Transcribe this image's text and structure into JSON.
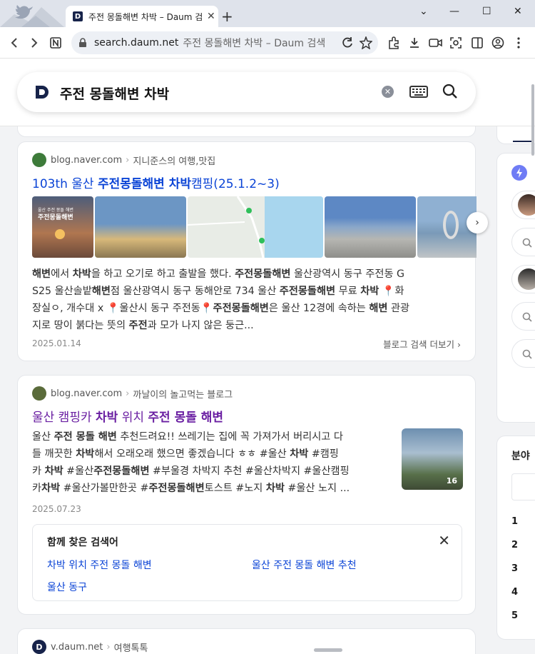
{
  "browser": {
    "tab_title": "주전 몽돌해변 차박 – Daum 검색",
    "tab_favicon": "D",
    "close_glyph": "✕",
    "new_tab_glyph": "+",
    "url": "search.daum.net",
    "url_title": "주전 몽돌해변 차박 – Daum 검색",
    "win_down": "⌄",
    "win_min": "—",
    "win_max": "☐",
    "win_close": "✕"
  },
  "search": {
    "query": "주전 몽돌해변 차박"
  },
  "results": [
    {
      "domain": "blog.naver.com",
      "blog_name": "지니준스의 여행,맛집",
      "title_pre": "103th 울산 ",
      "title_bold": "주전몽돌해변 차박",
      "title_post": "캠핑(25.1.2~3)",
      "desc_lines": [
        "<b>해변</b>에서 <b>차박</b>을 하고 오기로 하고 출발을 했다. <b>주전몽돌해변</b> 울산광역시 동구 주전동 G",
        "S25 울산솔밭<b>해변</b>점 울산광역시 동구 동해안로 734  울산 <b>주전몽돌해변</b> 무료 <b>차박</b> 📍화",
        "장실ㅇ, 개수대 x 📍울산시 동구 주전동📍<b>주전몽돌해변</b>은 울산 12경에 속하는 <b>해변</b> 관광",
        "지로 땅이 붉다는 뜻의 <b>주전</b>과 모가 나지 않은 둥근..."
      ],
      "date": "2025.01.14",
      "more_label": "블로그 검색 더보기 ›",
      "thumb_next": "›"
    },
    {
      "domain": "blog.naver.com",
      "blog_name": "까날이의 놀고먹는 블로그",
      "title_html": "울산 캠핑카 <b>차박</b> 위치 <b>주전 몽돌 해변</b>",
      "desc_lines": [
        "울산 <b>주전 몽돌 해변</b> 추천드려요!! 쓰레기는 집에 꼭 가져가서 버리시고 다",
        "들 깨끗한 <b>차박</b>해서 오래오래 했으면 좋겠습니다 ㅎㅎ  #울산 <b>차박</b> #캠핑",
        "카 <b>차박</b> #울산<b>주전몽돌해변</b> #부울경 차박지 추천 #울산차박지 #울산캠핑",
        "카<b>차박</b> #울산가볼만한곳 #<b>주전몽돌해변</b>토스트 #노지 <b>차박</b> #울산 노지 ..."
      ],
      "thumb_count": "16",
      "date": "2025.07.23"
    }
  ],
  "related": {
    "title": "함께 찾은 검색어",
    "close": "✕",
    "items": [
      "차박 위치 주전 몽돌 해변",
      "울산 주전 몽돌 해변 추천",
      "울산 동구"
    ]
  },
  "third": {
    "domain": "v.daum.net",
    "category": "여행톡톡"
  },
  "sidebar": {
    "section_label": "분야",
    "ranks": [
      "1",
      "2",
      "3",
      "4",
      "5"
    ]
  },
  "colors": {
    "link": "#0b44d6",
    "visited": "#6a1fa2",
    "brand": "#17234a"
  }
}
